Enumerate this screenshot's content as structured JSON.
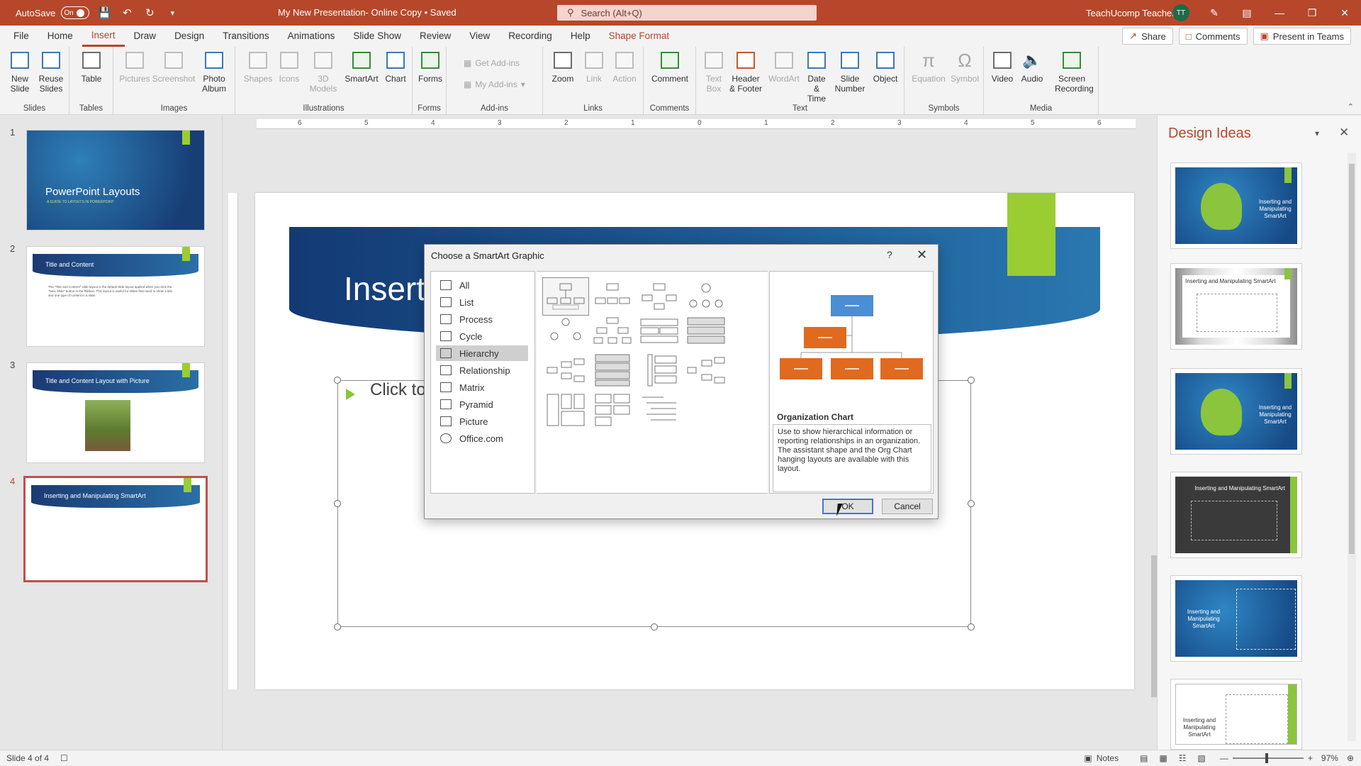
{
  "titlebar": {
    "autosave_label": "AutoSave",
    "autosave_state": "On",
    "doc_title": "My New Presentation- Online Copy  •  Saved",
    "search_placeholder": "Search (Alt+Q)",
    "user_name": "TeachUcomp Teacher",
    "user_initials": "TT"
  },
  "menu": {
    "tabs": [
      "File",
      "Home",
      "Insert",
      "Draw",
      "Design",
      "Transitions",
      "Animations",
      "Slide Show",
      "Review",
      "View",
      "Recording",
      "Help",
      "Shape Format"
    ],
    "active_tab": "Insert",
    "share": "Share",
    "comments": "Comments",
    "present": "Present in Teams"
  },
  "ribbon": {
    "groups": {
      "slides": "Slides",
      "tables": "Tables",
      "images": "Images",
      "illustrations": "Illustrations",
      "forms": "Forms",
      "addins": "Add-ins",
      "links": "Links",
      "comments": "Comments",
      "text": "Text",
      "symbols": "Symbols",
      "media": "Media"
    },
    "buttons": {
      "new_slide": "New Slide",
      "reuse_slides": "Reuse Slides",
      "table": "Table",
      "pictures": "Pictures",
      "screenshot": "Screenshot",
      "photo_album": "Photo Album",
      "shapes": "Shapes",
      "icons": "Icons",
      "models": "3D Models",
      "smartart": "SmartArt",
      "chart": "Chart",
      "forms": "Forms",
      "get_addins": "Get Add-ins",
      "my_addins": "My Add-ins",
      "zoom": "Zoom",
      "link": "Link",
      "action": "Action",
      "comment": "Comment",
      "text_box": "Text Box",
      "header_footer": "Header & Footer",
      "wordart": "WordArt",
      "date_time": "Date & Time",
      "slide_number": "Slide Number",
      "object": "Object",
      "equation": "Equation",
      "symbol": "Symbol",
      "video": "Video",
      "audio": "Audio",
      "screen_recording": "Screen Recording"
    }
  },
  "slides": [
    {
      "num": "1",
      "title": "PowerPoint Layouts",
      "subtitle": "A GUIDE TO LAYOUTS IN POWERPOINT"
    },
    {
      "num": "2",
      "title": "Title and Content",
      "body": "The \"Title and Content\" slide layout is the default slide layout applied when you click the \"New Slide\" button in the Ribbon. This layout is useful for slides that need to show a title and one type of content in a slide."
    },
    {
      "num": "3",
      "title": "Title and Content Layout with Picture"
    },
    {
      "num": "4",
      "title": "Inserting and Manipulating SmartArt"
    }
  ],
  "ruler_ticks": [
    "6",
    "5",
    "4",
    "3",
    "2",
    "1",
    "0",
    "1",
    "2",
    "3",
    "4",
    "5",
    "6"
  ],
  "slide": {
    "title_partial": "Insert",
    "placeholder_partial": "Click to"
  },
  "design_ideas": {
    "title": "Design Ideas",
    "card_text": "Inserting and Manipulating SmartArt"
  },
  "dialog": {
    "title": "Choose a SmartArt Graphic",
    "help": "?",
    "categories": [
      "All",
      "List",
      "Process",
      "Cycle",
      "Hierarchy",
      "Relationship",
      "Matrix",
      "Pyramid",
      "Picture",
      "Office.com"
    ],
    "selected_category": "Hierarchy",
    "preview_name": "Organization Chart",
    "preview_desc": "Use to show hierarchical information or reporting relationships in an organization. The assistant shape and the Org Chart hanging layouts are available with this layout.",
    "ok": "OK",
    "cancel": "Cancel"
  },
  "statusbar": {
    "slide_info": "Slide 4 of 4",
    "notes": "Notes",
    "zoom": "97%"
  },
  "colors": {
    "accent": "#b7472a",
    "slide_green": "#9acd32",
    "slide_blue": "#1b3a73",
    "org_orange": "#e06a1f",
    "org_blue": "#4a8ed4"
  }
}
